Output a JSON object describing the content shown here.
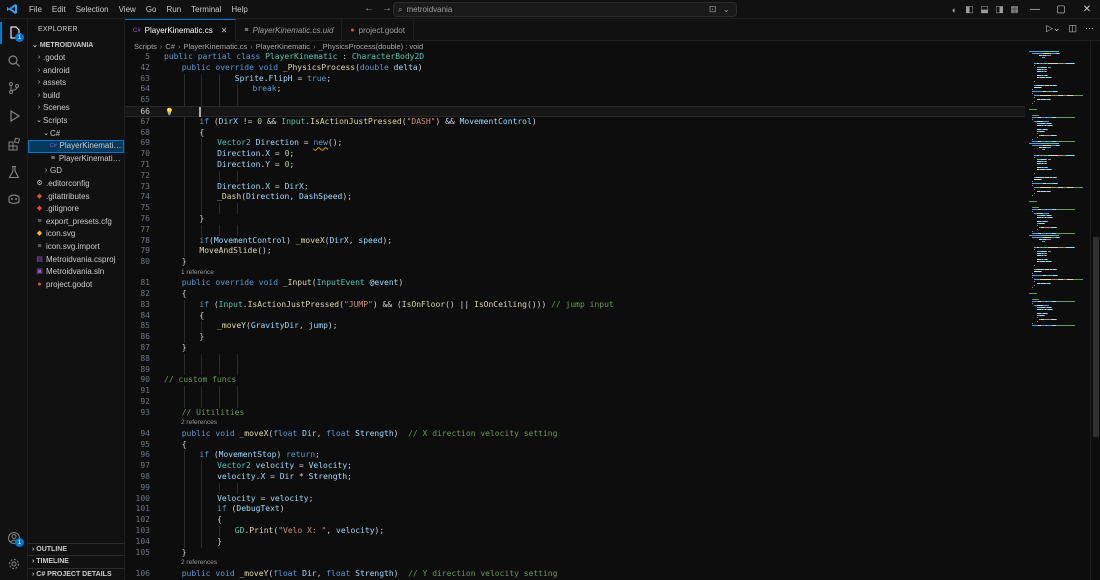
{
  "titlebar": {
    "menu": [
      "File",
      "Edit",
      "Selection",
      "View",
      "Go",
      "Run",
      "Terminal",
      "Help"
    ],
    "search_value": "metroidvania"
  },
  "activity": {
    "explorer_badge": "1",
    "source_control_badge": "",
    "extensions_badge": "",
    "accounts_badge": "1"
  },
  "explorer": {
    "header": "EXPLORER",
    "root": "METROIDVANIA",
    "items": [
      {
        "label": ".godot",
        "depth": 1,
        "kind": "folder",
        "open": false
      },
      {
        "label": "android",
        "depth": 1,
        "kind": "folder",
        "open": false
      },
      {
        "label": "assets",
        "depth": 1,
        "kind": "folder",
        "open": false
      },
      {
        "label": "build",
        "depth": 1,
        "kind": "folder",
        "open": false
      },
      {
        "label": "Scenes",
        "depth": 1,
        "kind": "folder",
        "open": false
      },
      {
        "label": "Scripts",
        "depth": 1,
        "kind": "folder",
        "open": true
      },
      {
        "label": "C#",
        "depth": 2,
        "kind": "folder",
        "open": true
      },
      {
        "label": "PlayerKinematic.cs",
        "depth": 3,
        "kind": "cs",
        "selected": true
      },
      {
        "label": "PlayerKinematic.cs...",
        "depth": 3,
        "kind": "uid"
      },
      {
        "label": "GD",
        "depth": 2,
        "kind": "folder",
        "open": false
      },
      {
        "label": ".editorconfig",
        "depth": 1,
        "kind": "gear"
      },
      {
        "label": ".gitattributes",
        "depth": 1,
        "kind": "git"
      },
      {
        "label": ".gitignore",
        "depth": 1,
        "kind": "git"
      },
      {
        "label": "export_presets.cfg",
        "depth": 1,
        "kind": "cfg"
      },
      {
        "label": "icon.svg",
        "depth": 1,
        "kind": "svg"
      },
      {
        "label": "icon.svg.import",
        "depth": 1,
        "kind": "cfg"
      },
      {
        "label": "Metroidvania.csproj",
        "depth": 1,
        "kind": "proj"
      },
      {
        "label": "Metroidvania.sln",
        "depth": 1,
        "kind": "sln"
      },
      {
        "label": "project.godot",
        "depth": 1,
        "kind": "godot"
      }
    ],
    "sections": [
      "OUTLINE",
      "TIMELINE",
      "C# PROJECT DETAILS"
    ]
  },
  "tabs": [
    {
      "label": "PlayerKinematic.cs",
      "active": true,
      "italic": false,
      "icon": "cs"
    },
    {
      "label": "PlayerKinematic.cs.uid",
      "active": false,
      "italic": true,
      "icon": "uid"
    },
    {
      "label": "project.godot",
      "active": false,
      "italic": false,
      "icon": "godot"
    }
  ],
  "breadcrumb": [
    "Scripts",
    "C#",
    "PlayerKinematic.cs",
    "PlayerKinematic",
    "_PhysicsProcess(double) : void"
  ],
  "code_lines": [
    {
      "n": "5",
      "indent": 0,
      "sticky": true,
      "tokens": [
        [
          "kw",
          "public partial class "
        ],
        [
          "ty",
          "PlayerKinematic"
        ],
        [
          "pl",
          " : "
        ],
        [
          "ty",
          "CharacterBody2D"
        ]
      ]
    },
    {
      "n": "42",
      "indent": 1,
      "sticky": true,
      "tokens": [
        [
          "kw",
          "public override void "
        ],
        [
          "fn",
          "_PhysicsProcess"
        ],
        [
          "pl",
          "("
        ],
        [
          "kw",
          "double "
        ],
        [
          "va",
          "delta"
        ],
        [
          "pl",
          ")"
        ]
      ]
    },
    {
      "n": "63",
      "indent": 4,
      "tokens": [
        [
          "va",
          "Sprite"
        ],
        [
          "pl",
          "."
        ],
        [
          "va",
          "FlipH"
        ],
        [
          "pl",
          " = "
        ],
        [
          "kw",
          "true"
        ],
        [
          "pl",
          ";"
        ]
      ]
    },
    {
      "n": "64",
      "indent": 5,
      "tokens": [
        [
          "kw",
          "break"
        ],
        [
          "pl",
          ";"
        ]
      ]
    },
    {
      "n": "65",
      "indent": 0,
      "tokens": []
    },
    {
      "n": "66",
      "indent": 2,
      "current": true,
      "tokens": []
    },
    {
      "n": "67",
      "indent": 2,
      "tokens": [
        [
          "kw",
          "if "
        ],
        [
          "pl",
          "("
        ],
        [
          "va",
          "DirX"
        ],
        [
          "pl",
          " != "
        ],
        [
          "nu",
          "0"
        ],
        [
          "pl",
          " && "
        ],
        [
          "ty",
          "Input"
        ],
        [
          "pl",
          "."
        ],
        [
          "fn",
          "IsActionJustPressed"
        ],
        [
          "pl",
          "("
        ],
        [
          "st",
          "\"DASH\""
        ],
        [
          "pl",
          ") && "
        ],
        [
          "va",
          "MovementControl"
        ],
        [
          "pl",
          ")"
        ]
      ]
    },
    {
      "n": "68",
      "indent": 2,
      "tokens": [
        [
          "pl",
          "{"
        ]
      ]
    },
    {
      "n": "69",
      "indent": 3,
      "tokens": [
        [
          "ty",
          "Vector2 "
        ],
        [
          "va",
          "Direction"
        ],
        [
          "pl",
          " = "
        ],
        [
          "kw",
          "new"
        ],
        [
          "pl",
          "();"
        ]
      ]
    },
    {
      "n": "70",
      "indent": 3,
      "tokens": [
        [
          "va",
          "Direction"
        ],
        [
          "pl",
          "."
        ],
        [
          "va",
          "X"
        ],
        [
          "pl",
          " = "
        ],
        [
          "nu",
          "0"
        ],
        [
          "pl",
          ";"
        ]
      ]
    },
    {
      "n": "71",
      "indent": 3,
      "tokens": [
        [
          "va",
          "Direction"
        ],
        [
          "pl",
          "."
        ],
        [
          "va",
          "Y"
        ],
        [
          "pl",
          " = "
        ],
        [
          "nu",
          "0"
        ],
        [
          "pl",
          ";"
        ]
      ]
    },
    {
      "n": "72",
      "indent": 0,
      "tokens": []
    },
    {
      "n": "73",
      "indent": 3,
      "tokens": [
        [
          "va",
          "Direction"
        ],
        [
          "pl",
          "."
        ],
        [
          "va",
          "X"
        ],
        [
          "pl",
          " = "
        ],
        [
          "va",
          "DirX"
        ],
        [
          "pl",
          ";"
        ]
      ]
    },
    {
      "n": "74",
      "indent": 3,
      "tokens": [
        [
          "fn",
          "_Dash"
        ],
        [
          "pl",
          "("
        ],
        [
          "va",
          "Direction"
        ],
        [
          "pl",
          ", "
        ],
        [
          "va",
          "DashSpeed"
        ],
        [
          "pl",
          ");"
        ]
      ]
    },
    {
      "n": "75",
      "indent": 0,
      "tokens": []
    },
    {
      "n": "76",
      "indent": 2,
      "tokens": [
        [
          "pl",
          "}"
        ]
      ]
    },
    {
      "n": "77",
      "indent": 0,
      "tokens": []
    },
    {
      "n": "78",
      "indent": 2,
      "tokens": [
        [
          "kw",
          "if"
        ],
        [
          "pl",
          "("
        ],
        [
          "va",
          "MovementControl"
        ],
        [
          "pl",
          ") "
        ],
        [
          "fn",
          "_moveX"
        ],
        [
          "pl",
          "("
        ],
        [
          "va",
          "DirX"
        ],
        [
          "pl",
          ", "
        ],
        [
          "va",
          "speed"
        ],
        [
          "pl",
          ");"
        ]
      ]
    },
    {
      "n": "79",
      "indent": 2,
      "tokens": [
        [
          "fn",
          "MoveAndSlide"
        ],
        [
          "pl",
          "();"
        ]
      ]
    },
    {
      "n": "80",
      "indent": 1,
      "tokens": [
        [
          "pl",
          "}"
        ]
      ],
      "lens": "1 reference"
    },
    {
      "n": "81",
      "indent": 1,
      "tokens": [
        [
          "kw",
          "public override void "
        ],
        [
          "fn",
          "_Input"
        ],
        [
          "pl",
          "("
        ],
        [
          "ty",
          "InputEvent "
        ],
        [
          "va",
          "@event"
        ],
        [
          "pl",
          ")"
        ]
      ]
    },
    {
      "n": "82",
      "indent": 1,
      "tokens": [
        [
          "pl",
          "{"
        ]
      ]
    },
    {
      "n": "83",
      "indent": 2,
      "tokens": [
        [
          "kw",
          "if "
        ],
        [
          "pl",
          "("
        ],
        [
          "ty",
          "Input"
        ],
        [
          "pl",
          "."
        ],
        [
          "fn",
          "IsActionJustPressed"
        ],
        [
          "pl",
          "("
        ],
        [
          "st",
          "\"JUMP\""
        ],
        [
          "pl",
          ") && ("
        ],
        [
          "fn",
          "IsOnFloor"
        ],
        [
          "pl",
          "() || "
        ],
        [
          "fn",
          "IsOnCeiling"
        ],
        [
          "pl",
          "())) "
        ],
        [
          "cm",
          "// jump input"
        ]
      ]
    },
    {
      "n": "84",
      "indent": 2,
      "tokens": [
        [
          "pl",
          "{"
        ]
      ]
    },
    {
      "n": "85",
      "indent": 3,
      "tokens": [
        [
          "fn",
          "_moveY"
        ],
        [
          "pl",
          "("
        ],
        [
          "va",
          "GravityDir"
        ],
        [
          "pl",
          ", "
        ],
        [
          "va",
          "jump"
        ],
        [
          "pl",
          ");"
        ]
      ]
    },
    {
      "n": "86",
      "indent": 2,
      "tokens": [
        [
          "pl",
          "}"
        ]
      ]
    },
    {
      "n": "87",
      "indent": 1,
      "tokens": [
        [
          "pl",
          "}"
        ]
      ]
    },
    {
      "n": "88",
      "indent": 0,
      "tokens": []
    },
    {
      "n": "89",
      "indent": 0,
      "tokens": []
    },
    {
      "n": "90",
      "indent": 0,
      "tokens": [
        [
          "cm",
          "// custom funcs"
        ]
      ]
    },
    {
      "n": "91",
      "indent": 0,
      "tokens": []
    },
    {
      "n": "92",
      "indent": 0,
      "tokens": []
    },
    {
      "n": "93",
      "indent": 1,
      "tokens": [
        [
          "cm",
          "// Uitilities"
        ]
      ],
      "lens": "2 references"
    },
    {
      "n": "94",
      "indent": 1,
      "tokens": [
        [
          "kw",
          "public void "
        ],
        [
          "fn",
          "_moveX"
        ],
        [
          "pl",
          "("
        ],
        [
          "kw",
          "float "
        ],
        [
          "va",
          "Dir"
        ],
        [
          "pl",
          ", "
        ],
        [
          "kw",
          "float "
        ],
        [
          "va",
          "Strength"
        ],
        [
          "pl",
          ")  "
        ],
        [
          "cm",
          "// X direction velocity setting"
        ]
      ]
    },
    {
      "n": "95",
      "indent": 1,
      "tokens": [
        [
          "pl",
          "{"
        ]
      ]
    },
    {
      "n": "96",
      "indent": 2,
      "tokens": [
        [
          "kw",
          "if "
        ],
        [
          "pl",
          "("
        ],
        [
          "va",
          "MovementStop"
        ],
        [
          "pl",
          ") "
        ],
        [
          "kw",
          "return"
        ],
        [
          "pl",
          ";"
        ]
      ]
    },
    {
      "n": "97",
      "indent": 3,
      "tokens": [
        [
          "ty",
          "Vector2 "
        ],
        [
          "va",
          "velocity"
        ],
        [
          "pl",
          " = "
        ],
        [
          "va",
          "Velocity"
        ],
        [
          "pl",
          ";"
        ]
      ]
    },
    {
      "n": "98",
      "indent": 3,
      "tokens": [
        [
          "va",
          "velocity"
        ],
        [
          "pl",
          "."
        ],
        [
          "va",
          "X"
        ],
        [
          "pl",
          " = "
        ],
        [
          "va",
          "Dir"
        ],
        [
          "pl",
          " * "
        ],
        [
          "va",
          "Strength"
        ],
        [
          "pl",
          ";"
        ]
      ]
    },
    {
      "n": "99",
      "indent": 0,
      "tokens": []
    },
    {
      "n": "100",
      "indent": 3,
      "tokens": [
        [
          "va",
          "Velocity"
        ],
        [
          "pl",
          " = "
        ],
        [
          "va",
          "velocity"
        ],
        [
          "pl",
          ";"
        ]
      ]
    },
    {
      "n": "101",
      "indent": 3,
      "tokens": [
        [
          "kw",
          "if "
        ],
        [
          "pl",
          "("
        ],
        [
          "va",
          "DebugText"
        ],
        [
          "pl",
          ")"
        ]
      ]
    },
    {
      "n": "102",
      "indent": 3,
      "tokens": [
        [
          "pl",
          "{"
        ]
      ]
    },
    {
      "n": "103",
      "indent": 4,
      "tokens": [
        [
          "ty",
          "GD"
        ],
        [
          "pl",
          "."
        ],
        [
          "fn",
          "Print"
        ],
        [
          "pl",
          "("
        ],
        [
          "st",
          "\"Velo X: \""
        ],
        [
          "pl",
          ", "
        ],
        [
          "va",
          "velocity"
        ],
        [
          "pl",
          ");"
        ]
      ]
    },
    {
      "n": "104",
      "indent": 3,
      "tokens": [
        [
          "pl",
          "}"
        ]
      ]
    },
    {
      "n": "105",
      "indent": 1,
      "tokens": [
        [
          "pl",
          "}"
        ]
      ],
      "lens": "2 references"
    },
    {
      "n": "106",
      "indent": 1,
      "tokens": [
        [
          "kw",
          "public void "
        ],
        [
          "fn",
          "_moveY"
        ],
        [
          "pl",
          "("
        ],
        [
          "kw",
          "float "
        ],
        [
          "va",
          "Dir"
        ],
        [
          "pl",
          ", "
        ],
        [
          "kw",
          "float "
        ],
        [
          "va",
          "Strength"
        ],
        [
          "pl",
          ")  "
        ],
        [
          "cm",
          "// Y direction velocity setting"
        ]
      ]
    }
  ]
}
